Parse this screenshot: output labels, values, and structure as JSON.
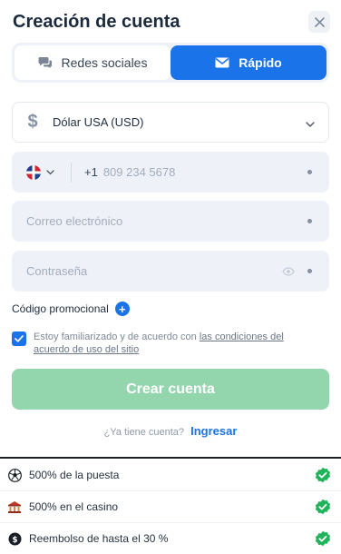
{
  "header": {
    "title": "Creación de cuenta",
    "close_icon": "close-icon"
  },
  "tabs": [
    {
      "label": "Redes sociales",
      "icon": "chat-bubbles-icon",
      "active": false
    },
    {
      "label": "Rápido",
      "icon": "envelope-icon",
      "active": true
    }
  ],
  "currency": {
    "label": "Dólar USA (USD)",
    "icon": "dollar-icon"
  },
  "phone": {
    "flag": "dominican-republic-flag-icon",
    "prefix": "+1",
    "placeholder": "809 234 5678"
  },
  "email": {
    "placeholder": "Correo electrónico"
  },
  "password": {
    "placeholder": "Contraseña"
  },
  "promo": {
    "label": "Código promocional",
    "plus": "+"
  },
  "agreement": {
    "checked": true,
    "text": "Estoy familiarizado y de acuerdo con",
    "link": "las condiciones del acuerdo de uso del sitio"
  },
  "create_button": {
    "label": "Crear cuenta"
  },
  "login": {
    "question": "¿Ya tiene cuenta?",
    "link": "Ingresar"
  },
  "bonuses": [
    {
      "label": "500% de la puesta",
      "icon": "soccer-ball-icon"
    },
    {
      "label": "500% en el casino",
      "icon": "casino-icon"
    },
    {
      "label": "Reembolso de hasta el 30 %",
      "icon": "cashback-icon"
    }
  ],
  "colors": {
    "accent": "#1a73e8",
    "create_button": "#93d6ad",
    "check_badge": "#1fb45a"
  }
}
